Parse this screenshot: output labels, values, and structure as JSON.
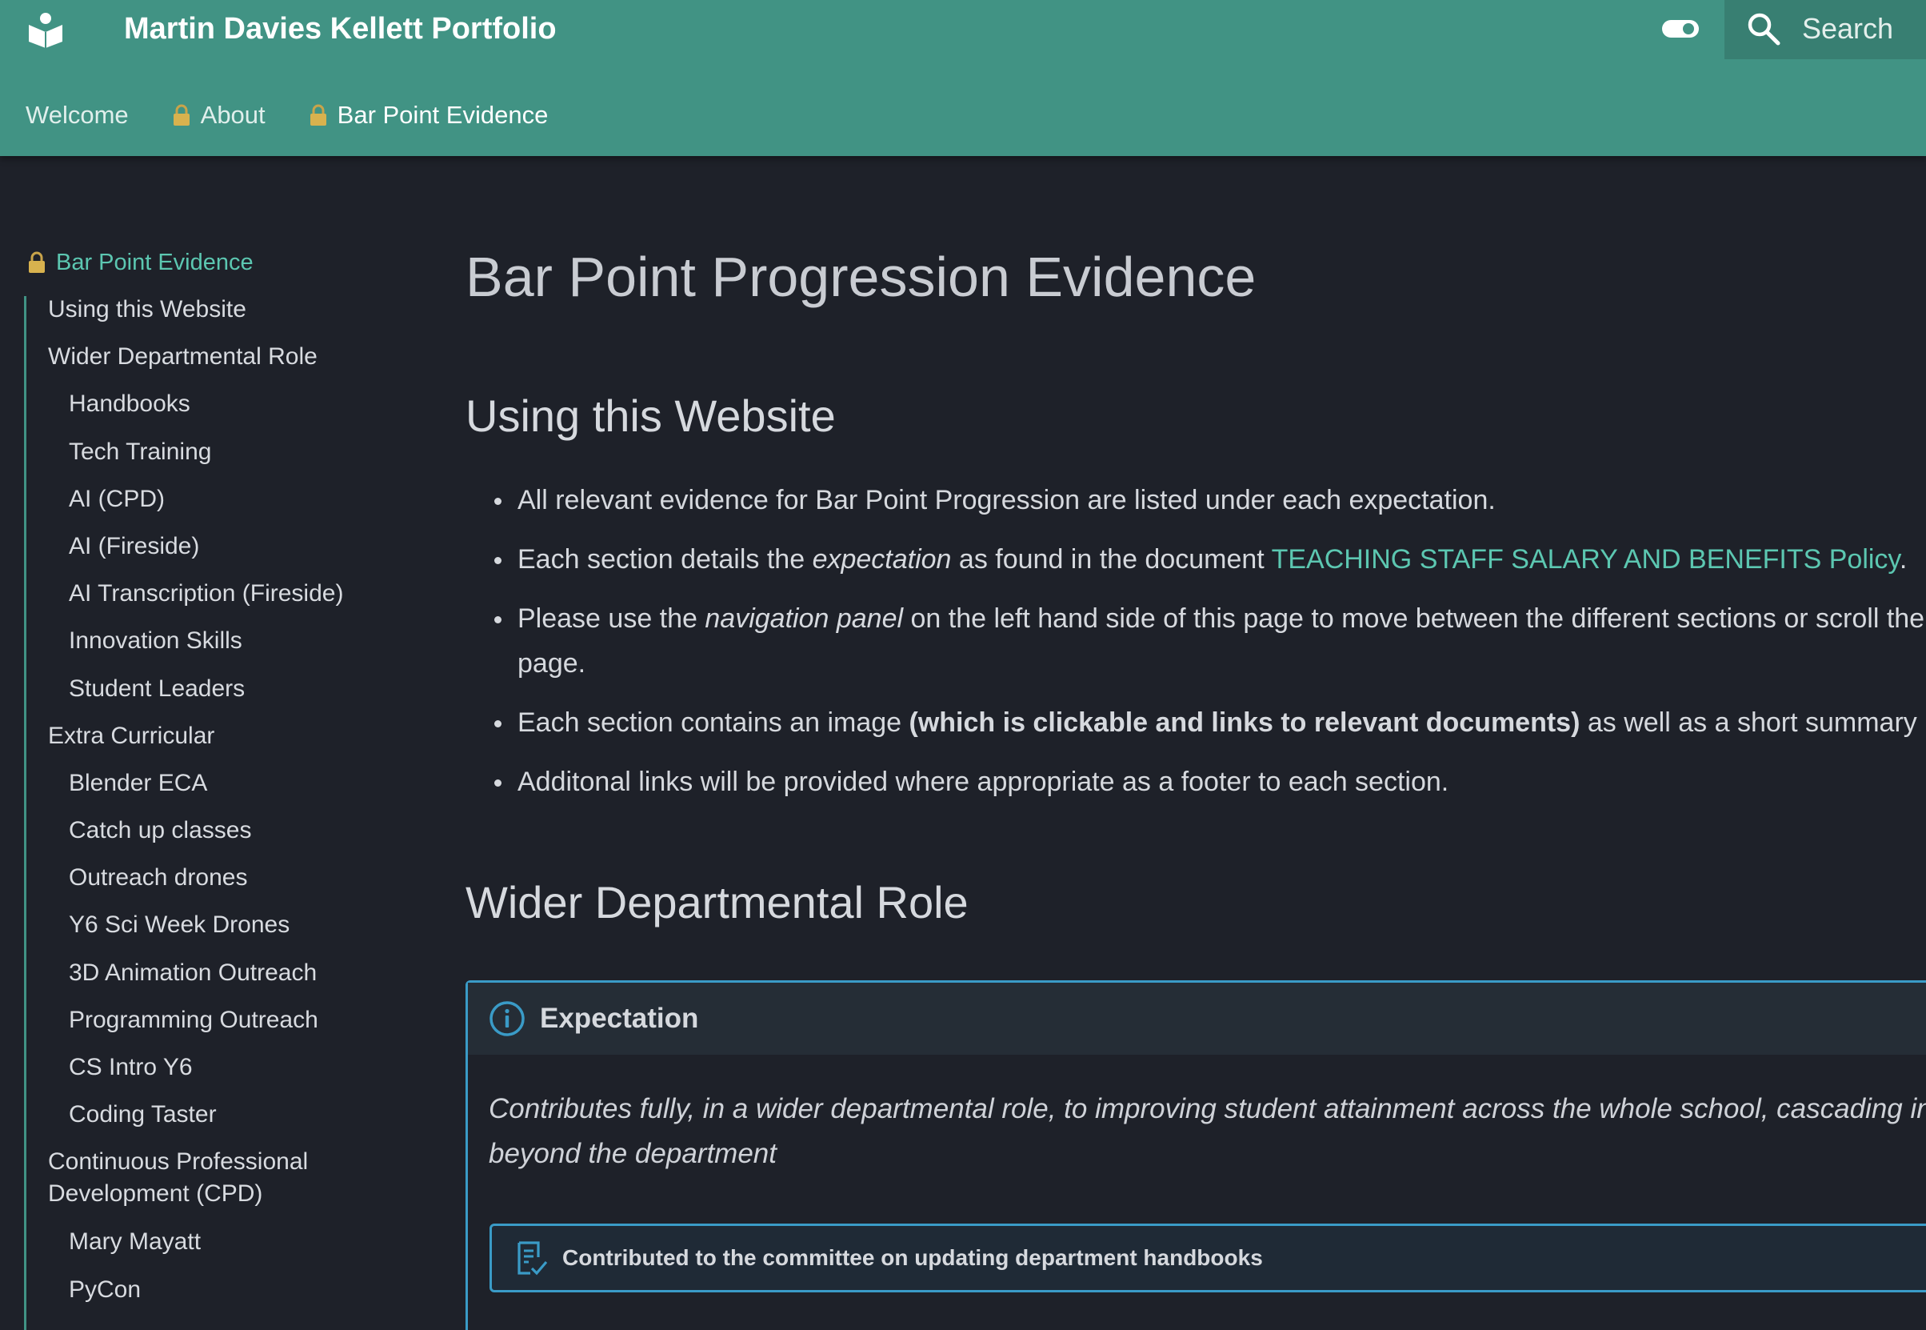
{
  "header": {
    "title": "Martin Davies Kellett Portfolio",
    "logo_icon": "book-open-icon",
    "toggle_icon": "toggle-switch-icon",
    "search_placeholder": "Search",
    "brand_color": "#419384"
  },
  "tabs": [
    {
      "label": "Welcome",
      "locked": false
    },
    {
      "label": "About",
      "locked": true
    },
    {
      "label": "Bar Point Evidence",
      "locked": true,
      "active": true
    }
  ],
  "sidebar": {
    "root_label": "Bar Point Evidence",
    "items": [
      {
        "label": "Using this Website",
        "level": 1
      },
      {
        "label": "Wider Departmental Role",
        "level": 1
      },
      {
        "label": "Handbooks",
        "level": 2
      },
      {
        "label": "Tech Training",
        "level": 2
      },
      {
        "label": "AI (CPD)",
        "level": 2
      },
      {
        "label": "AI (Fireside)",
        "level": 2
      },
      {
        "label": "AI Transcription (Fireside)",
        "level": 2
      },
      {
        "label": "Innovation Skills",
        "level": 2
      },
      {
        "label": "Student Leaders",
        "level": 2
      },
      {
        "label": "Extra Curricular",
        "level": 1
      },
      {
        "label": "Blender ECA",
        "level": 2
      },
      {
        "label": "Catch up classes",
        "level": 2
      },
      {
        "label": "Outreach drones",
        "level": 2
      },
      {
        "label": "Y6 Sci Week Drones",
        "level": 2
      },
      {
        "label": "3D Animation Outreach",
        "level": 2
      },
      {
        "label": "Programming Outreach",
        "level": 2
      },
      {
        "label": "CS Intro Y6",
        "level": 2
      },
      {
        "label": "Coding Taster",
        "level": 2
      },
      {
        "label": "Continuous Professional Development (CPD)",
        "level": 1
      },
      {
        "label": "Mary Mayatt",
        "level": 2
      },
      {
        "label": "PyCon",
        "level": 2
      }
    ]
  },
  "main": {
    "page_title": "Bar Point Progression Evidence",
    "section1_title": "Using this Website",
    "bullets": {
      "b1": "All relevant evidence for Bar Point Progression are listed under each expectation.",
      "b2_pre": "Each section details the ",
      "b2_em": "expectation",
      "b2_mid": " as found in the document ",
      "b2_link": "TEACHING STAFF SALARY AND BENEFITS Policy",
      "b2_post": ".",
      "b3_pre": "Please use the ",
      "b3_em": "navigation panel",
      "b3_post": " on the left hand side of this page to move between the different sections or scroll the page.",
      "b4_pre": "Each section contains an image ",
      "b4_strong": "(which is clickable and links to relevant documents)",
      "b4_post": " as well as a short summary",
      "b5": "Additonal links will be provided where appropriate as a footer to each section."
    },
    "section2_title": "Wider Departmental Role",
    "admonition": {
      "title": "Expectation",
      "icon": "info-icon",
      "body": "Contributes fully, in a wider departmental role, to improving student attainment across the whole school, cascading inf beyond the department",
      "sub_title": "Contributed to the committee on updating department handbooks",
      "sub_icon": "checklist-icon",
      "accent_color": "#3a9bc7"
    }
  }
}
